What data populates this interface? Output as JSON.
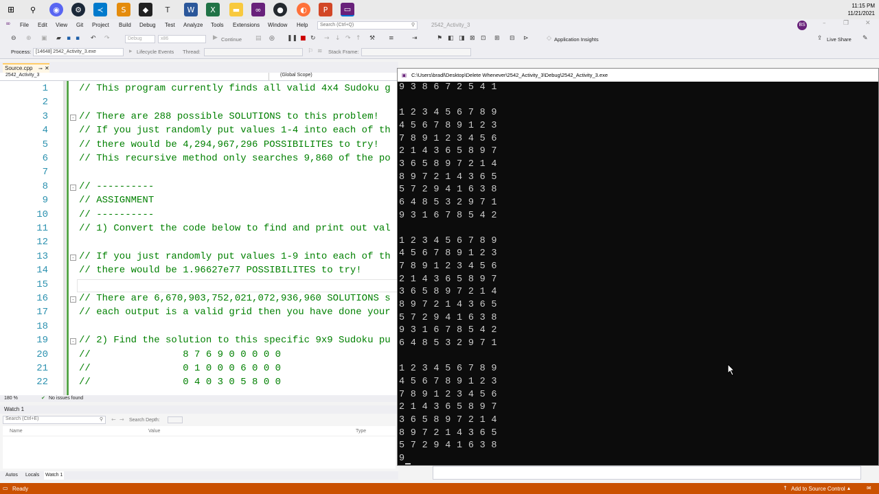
{
  "taskbar": {
    "clock_time": "11:15 PM",
    "clock_date": "11/21/2021",
    "icons": [
      "windows-start",
      "search",
      "discord",
      "steam",
      "visual-studio-code",
      "sublime",
      "unity",
      "tex",
      "word",
      "excel",
      "file-explorer",
      "visual-studio",
      "github",
      "firefox",
      "powerpoint",
      "visual-studio-active"
    ]
  },
  "menu": {
    "items": [
      "File",
      "Edit",
      "View",
      "Git",
      "Project",
      "Build",
      "Debug",
      "Test",
      "Analyze",
      "Tools",
      "Extensions",
      "Window",
      "Help"
    ],
    "search_placeholder": "Search (Ctrl+Q)",
    "solution_name": "2542_Activity_3",
    "user_initials": "BS",
    "live_share": "Live Share"
  },
  "toolbar": {
    "config": "Debug",
    "platform": "x86",
    "continue_label": "Continue",
    "app_insights": "Application Insights",
    "process_label": "Process:",
    "process_value": "[14648] 2542_Activity_3.exe",
    "lifecycle_label": "Lifecycle Events",
    "thread_label": "Thread:",
    "stack_label": "Stack Frame:"
  },
  "editor": {
    "tab_label": "Source.cpp",
    "project_scope": "2542_Activity_3",
    "global_scope": "(Global Scope)",
    "zoom": "180 %",
    "issues": "No issues found",
    "lines": [
      {
        "n": "1",
        "text": "// This program currently finds all valid 4x4 Sudoku g",
        "fold": ""
      },
      {
        "n": "2",
        "text": "",
        "fold": ""
      },
      {
        "n": "3",
        "text": "// There are 288 possible SOLUTIONS to this problem!",
        "fold": "-"
      },
      {
        "n": "4",
        "text": "// If you just randomly put values 1-4 into each of th",
        "fold": ""
      },
      {
        "n": "5",
        "text": "// there would be 4,294,967,296 POSSIBILITES to try!",
        "fold": ""
      },
      {
        "n": "6",
        "text": "// This recursive method only searches 9,860 of the po",
        "fold": ""
      },
      {
        "n": "7",
        "text": "",
        "fold": ""
      },
      {
        "n": "8",
        "text": "// ----------",
        "fold": "-"
      },
      {
        "n": "9",
        "text": "// ASSIGNMENT",
        "fold": ""
      },
      {
        "n": "10",
        "text": "// ----------",
        "fold": ""
      },
      {
        "n": "11",
        "text": "// 1) Convert the code below to find and print out val",
        "fold": ""
      },
      {
        "n": "12",
        "text": "",
        "fold": ""
      },
      {
        "n": "13",
        "text": "// If you just randomly put values 1-9 into each of th",
        "fold": "-"
      },
      {
        "n": "14",
        "text": "// there would be 1.96627e77 POSSIBILITES to try!",
        "fold": ""
      },
      {
        "n": "15",
        "text": "",
        "fold": ""
      },
      {
        "n": "16",
        "text": "// There are 6,670,903,752,021,072,936,960 SOLUTIONS s",
        "fold": "-"
      },
      {
        "n": "17",
        "text": "// each output is a valid grid then you have done your",
        "fold": ""
      },
      {
        "n": "18",
        "text": "",
        "fold": ""
      },
      {
        "n": "19",
        "text": "// 2) Find the solution to this specific 9x9 Sudoku pu",
        "fold": "-"
      },
      {
        "n": "20",
        "text": "//                8 7 6 9 0 0 0 0 0",
        "fold": ""
      },
      {
        "n": "21",
        "text": "//                0 1 0 0 0 6 0 0 0",
        "fold": ""
      },
      {
        "n": "22",
        "text": "//                0 4 0 3 0 5 8 0 0",
        "fold": ""
      }
    ]
  },
  "watch": {
    "title": "Watch 1",
    "search_placeholder": "Search (Ctrl+E)",
    "search_depth": "Search Depth:",
    "col_name": "Name",
    "col_value": "Value",
    "col_type": "Type",
    "bottom_tabs": [
      "Autos",
      "Locals",
      "Watch 1"
    ]
  },
  "status": {
    "ready": "Ready",
    "source_control": "Add to Source Control"
  },
  "console": {
    "title": "C:\\Users\\bradl\\Desktop\\Delete Whenever\\2542_Activity_3\\Debug\\2542_Activity_3.exe",
    "rows": [
      "9 3 8 6 7 2 5 4 1",
      "",
      "1 2 3 4 5 6 7 8 9",
      "4 5 6 7 8 9 1 2 3",
      "7 8 9 1 2 3 4 5 6",
      "2 1 4 3 6 5 8 9 7",
      "3 6 5 8 9 7 2 1 4",
      "8 9 7 2 1 4 3 6 5",
      "5 7 2 9 4 1 6 3 8",
      "6 4 8 5 3 2 9 7 1",
      "9 3 1 6 7 8 5 4 2",
      "",
      "1 2 3 4 5 6 7 8 9",
      "4 5 6 7 8 9 1 2 3",
      "7 8 9 1 2 3 4 5 6",
      "2 1 4 3 6 5 8 9 7",
      "3 6 5 8 9 7 2 1 4",
      "8 9 7 2 1 4 3 6 5",
      "5 7 2 9 4 1 6 3 8",
      "9 3 1 6 7 8 5 4 2",
      "6 4 8 5 3 2 9 7 1",
      "",
      "1 2 3 4 5 6 7 8 9",
      "4 5 6 7 8 9 1 2 3",
      "7 8 9 1 2 3 4 5 6",
      "2 1 4 3 6 5 8 9 7",
      "3 6 5 8 9 7 2 1 4",
      "8 9 7 2 1 4 3 6 5",
      "5 7 2 9 4 1 6 3 8",
      "9"
    ]
  },
  "colors": {
    "accent": "#68217a",
    "status_bar": "#ca5100",
    "comment": "#008000",
    "line_number": "#2b91af"
  }
}
